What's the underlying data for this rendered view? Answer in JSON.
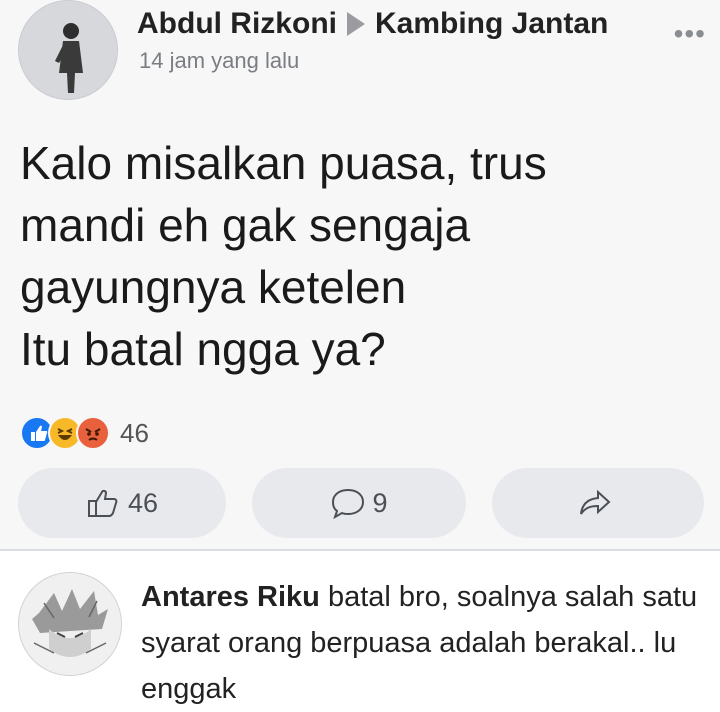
{
  "post": {
    "author": "Abdul Rizkoni",
    "group": "Kambing Jantan",
    "more_label": "•••",
    "time": "14 jam yang lalu",
    "text": "Kalo misalkan puasa, trus\nmandi eh gak sengaja\ngayungnya ketelen\nItu batal ngga ya?",
    "reaction_icons": [
      "like-icon",
      "haha-icon",
      "angry-icon"
    ],
    "reaction_count": "46"
  },
  "actions": {
    "like_count": "46",
    "comment_count": "9"
  },
  "comment": {
    "author": "Antares Riku",
    "text": " batal bro, soalnya salah satu syarat orang berpuasa adalah berakal.. lu enggak"
  },
  "colors": {
    "like_blue": "#1877f2",
    "haha_yellow": "#f7b928",
    "angry_orange": "#e8603c",
    "button_bg": "#e8e9ec"
  }
}
